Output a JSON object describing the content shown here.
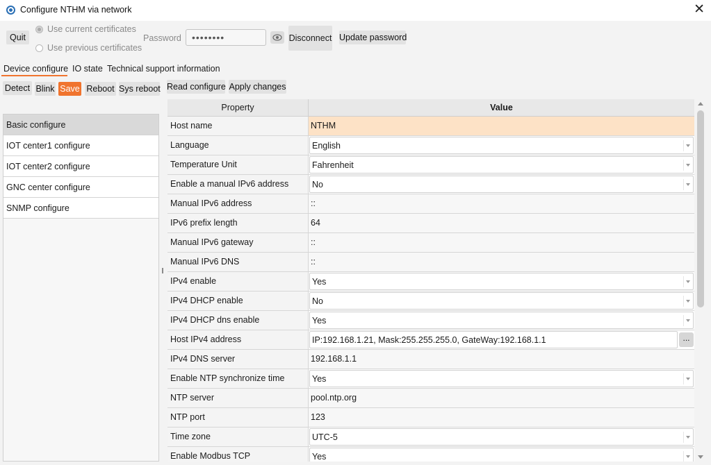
{
  "window": {
    "title": "Configure NTHM via network",
    "close_glyph": "✕"
  },
  "toolbar": {
    "quit": "Quit",
    "cert_current": "Use current certificates",
    "cert_previous": "Use previous certificates",
    "password_label": "Password",
    "password_value": "••••••••",
    "disconnect": "Disconnect",
    "update_password": "Update password"
  },
  "tabs": [
    "Device configure",
    "IO state",
    "Technical support information"
  ],
  "actions": {
    "detect": "Detect",
    "blink": "Blink",
    "save": "Save",
    "reboot": "Reboot",
    "sys_reboot": "Sys reboot",
    "read_configure": "Read configure",
    "apply_changes": "Apply changes"
  },
  "sections": [
    "Basic configure",
    "IOT center1 configure",
    "IOT center2 configure",
    "GNC center configure",
    "SNMP configure"
  ],
  "grid": {
    "header_property": "Property",
    "header_value": "Value",
    "rows": [
      {
        "property": "Host name",
        "value": "NTHM"
      },
      {
        "property": "Language",
        "value": "English"
      },
      {
        "property": "Temperature Unit",
        "value": "Fahrenheit"
      },
      {
        "property": "Enable a manual IPv6 address",
        "value": "No"
      },
      {
        "property": "Manual IPv6 address",
        "value": "::"
      },
      {
        "property": "IPv6 prefix length",
        "value": "64"
      },
      {
        "property": "Manual IPv6 gateway",
        "value": "::"
      },
      {
        "property": "Manual IPv6 DNS",
        "value": "::"
      },
      {
        "property": "IPv4 enable",
        "value": "Yes"
      },
      {
        "property": "IPv4 DHCP enable",
        "value": "No"
      },
      {
        "property": "IPv4 DHCP dns enable",
        "value": "Yes"
      },
      {
        "property": "Host IPv4 address",
        "value": "IP:192.168.1.21, Mask:255.255.255.0, GateWay:192.168.1.1"
      },
      {
        "property": "IPv4 DNS server",
        "value": "192.168.1.1"
      },
      {
        "property": "Enable NTP synchronize time",
        "value": "Yes"
      },
      {
        "property": "NTP server",
        "value": "pool.ntp.org"
      },
      {
        "property": "NTP port",
        "value": "123"
      },
      {
        "property": "Time zone",
        "value": "UTC-5"
      },
      {
        "property": "Enable Modbus TCP",
        "value": "Yes"
      }
    ],
    "ellipsis": "..."
  },
  "colors": {
    "accent": "#f0742e",
    "highlight": "#fde2c6",
    "selected_section": "#d9d9d9"
  },
  "icons": [
    "app-gear-icon",
    "close-icon",
    "eye-icon",
    "dropdown-arrow-icon"
  ]
}
